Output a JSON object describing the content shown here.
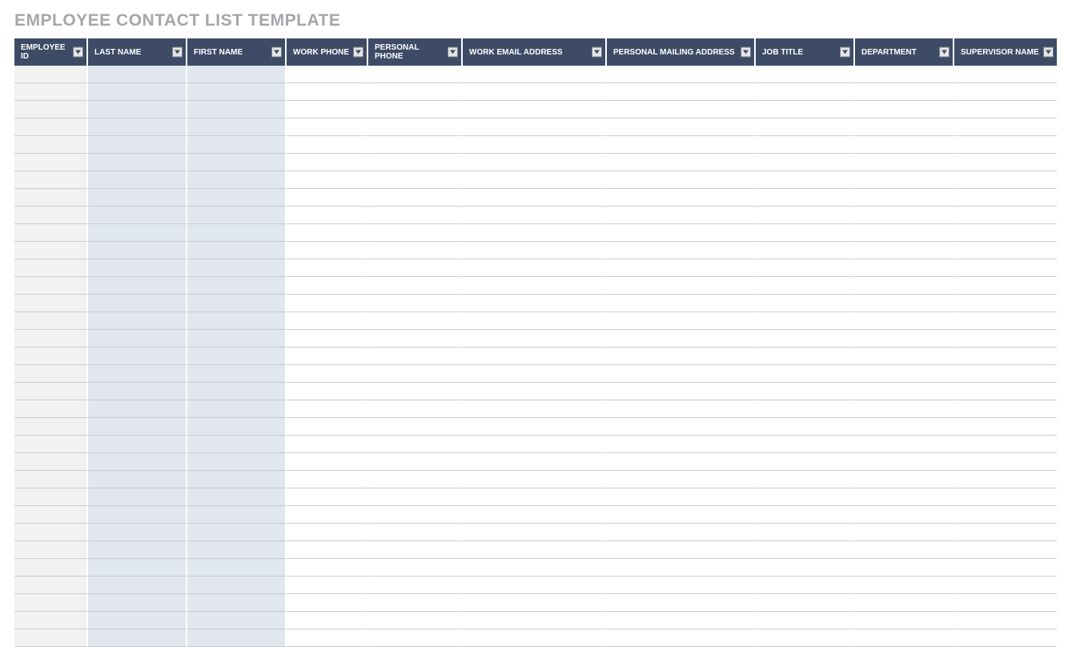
{
  "title": "EMPLOYEE CONTACT LIST TEMPLATE",
  "columns": [
    {
      "label": "EMPLOYEE ID",
      "shade": "grey"
    },
    {
      "label": "LAST NAME",
      "shade": "blue"
    },
    {
      "label": "FIRST NAME",
      "shade": "blue"
    },
    {
      "label": "WORK PHONE",
      "shade": "white"
    },
    {
      "label": "PERSONAL PHONE",
      "shade": "white"
    },
    {
      "label": "WORK EMAIL ADDRESS",
      "shade": "white"
    },
    {
      "label": "PERSONAL MAILING ADDRESS",
      "shade": "white"
    },
    {
      "label": "JOB TITLE",
      "shade": "white"
    },
    {
      "label": "DEPARTMENT",
      "shade": "white"
    },
    {
      "label": "SUPERVISOR NAME",
      "shade": "white"
    }
  ],
  "row_count": 33,
  "colors": {
    "header_bg": "#3d4b66",
    "title_text": "#a4a6a9",
    "shade_grey": "#f2f2f2",
    "shade_blue": "#e1e7ef",
    "grid_line": "#c9cbce"
  }
}
